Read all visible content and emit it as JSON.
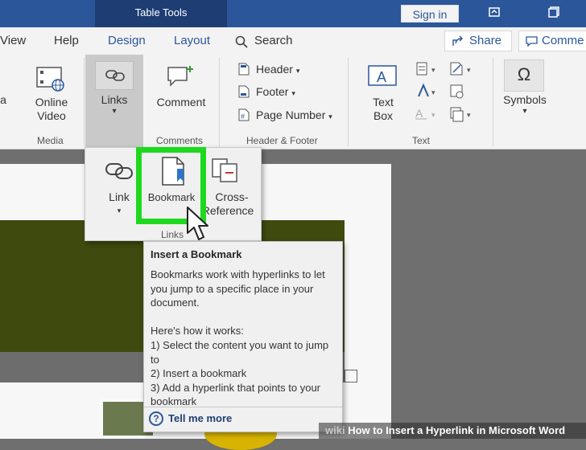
{
  "titlebar": {
    "context_tab": "Table Tools",
    "sign_in": "Sign in"
  },
  "menu": {
    "tabs": [
      "View",
      "Help",
      "Design",
      "Layout"
    ],
    "search": "Search",
    "share": "Share",
    "comments": "Comme"
  },
  "ribbon": {
    "online_video": "Online\nVideo",
    "media_group": "Media",
    "links": "Links",
    "comment": "Comment",
    "comments_group": "Comments",
    "header": "Header",
    "footer": "Footer",
    "page_number": "Page Number",
    "header_footer_group": "Header & Footer",
    "text_box": "Text\nBox",
    "text_group": "Text",
    "symbols": "Symbols"
  },
  "links_menu": {
    "link": "Link",
    "bookmark": "Bookmark",
    "cross_reference_1": "Cross-",
    "cross_reference_2": "Reference",
    "group": "Links"
  },
  "tooltip": {
    "title": "Insert a Bookmark",
    "desc": "Bookmarks work with hyperlinks to let you jump to a specific place in your document.",
    "how": "Here's how it works:",
    "step1": "1) Select the content you want to jump to",
    "step2": "2) Insert a bookmark",
    "step3": "3) Add a hyperlink that points to your bookmark",
    "tell_me_more": "Tell me more"
  },
  "watermark": {
    "wiki": "wiki",
    "text": "How to Insert a Hyperlink in Microsoft Word"
  },
  "colors": {
    "title_bar": "#2b579a",
    "highlight": "#1ed81e"
  }
}
